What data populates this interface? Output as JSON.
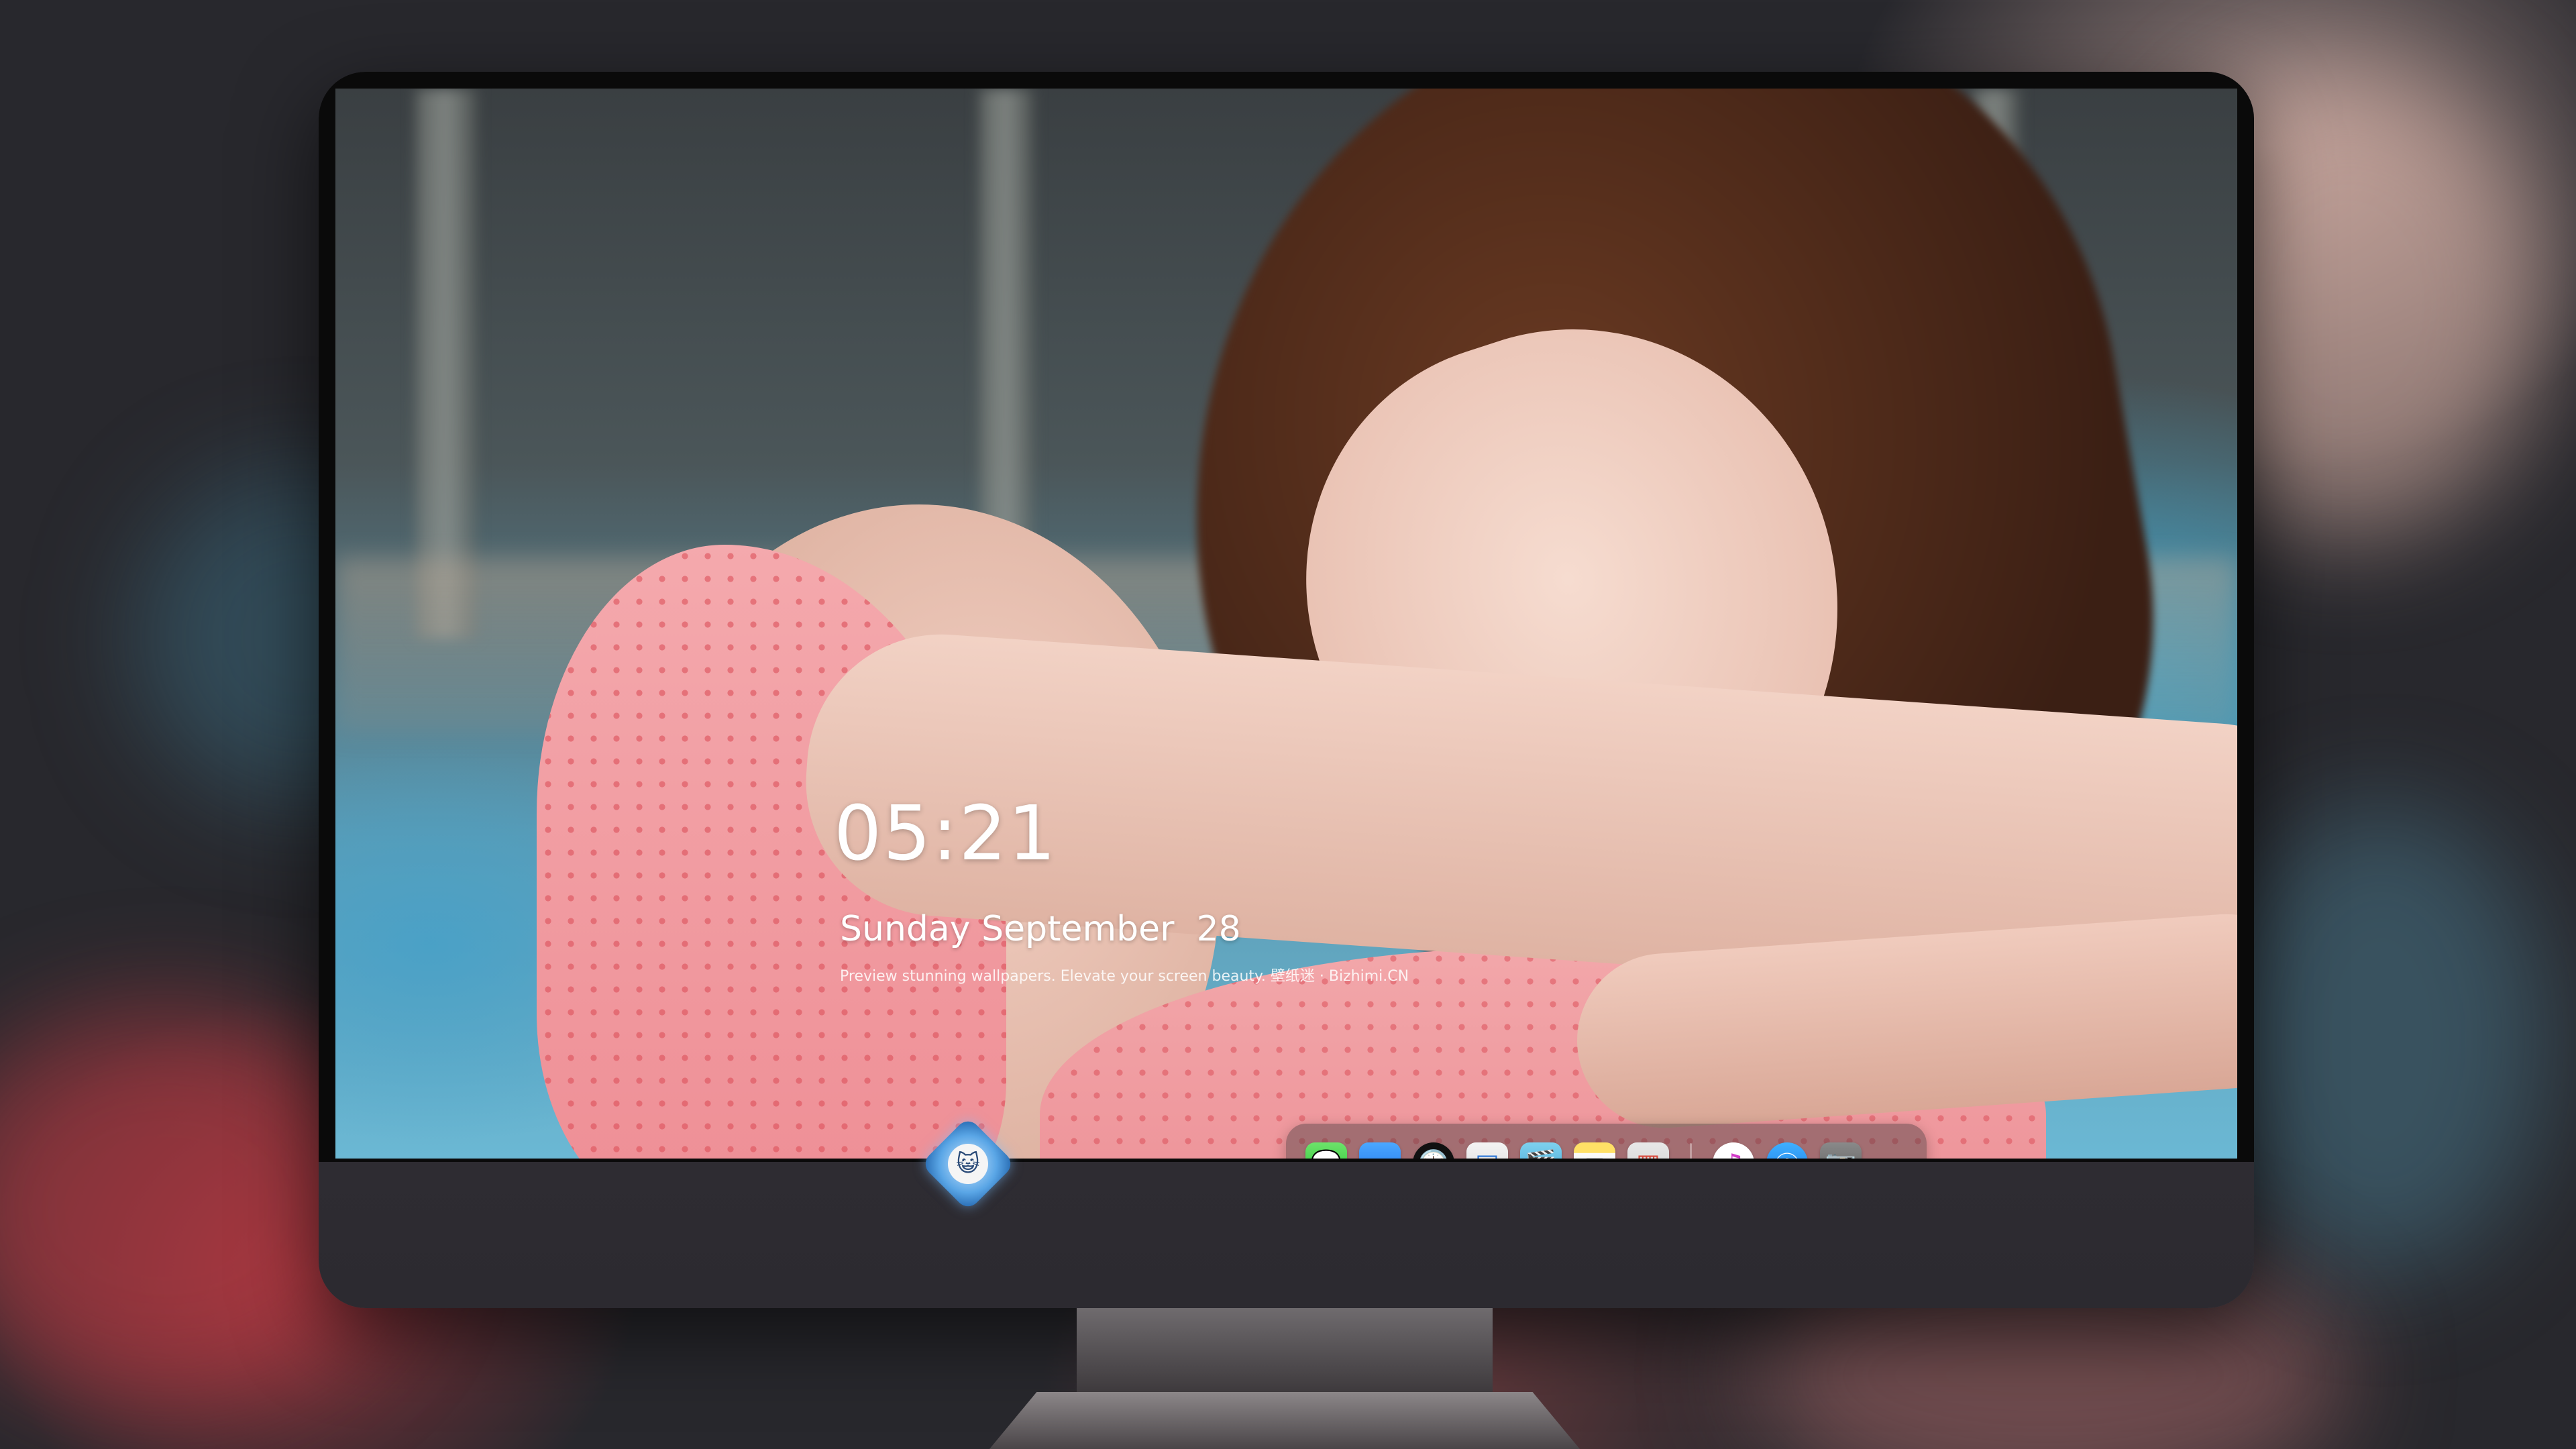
{
  "lockscreen": {
    "time": "05:21",
    "date": "Sunday September  28",
    "caption": "Preview stunning wallpapers. Elevate your screen beauty. 壁纸迷 · Bizhimi.CN"
  },
  "dock": {
    "apps": [
      {
        "name": "Messages",
        "icon": "messages-icon",
        "glyph": "💬"
      },
      {
        "name": "Weather",
        "icon": "weather-icon",
        "glyph": "☁"
      },
      {
        "name": "Clock",
        "icon": "clock-icon",
        "glyph": "🕑"
      },
      {
        "name": "Preview",
        "icon": "preview-icon",
        "glyph": "▣"
      },
      {
        "name": "Clips",
        "icon": "clapperboard-icon",
        "glyph": "🎬"
      },
      {
        "name": "Notes",
        "icon": "notes-icon",
        "glyph": "≡"
      },
      {
        "name": "Photo Booth",
        "icon": "photobooth-icon",
        "glyph": "▦"
      },
      {
        "name": "iTunes",
        "icon": "music-icon",
        "glyph": "♫"
      },
      {
        "name": "App Store",
        "icon": "appstore-icon",
        "glyph": "Ⓐ"
      },
      {
        "name": "Camera",
        "icon": "camera-icon",
        "glyph": "📷"
      }
    ]
  },
  "monitor": {
    "logo_icon": "cat-mascot-icon",
    "logo_glyph": "😺"
  },
  "colors": {
    "bezel": "#0a0a0a",
    "chin": "#2c2a30",
    "text": "#ffffff",
    "dock_bg": "rgba(70,60,62,0.45)"
  }
}
